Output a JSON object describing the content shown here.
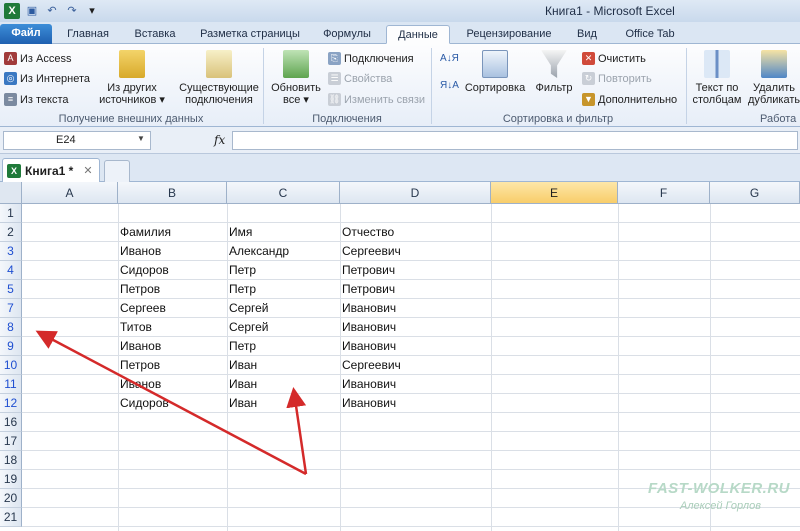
{
  "title_bar": {
    "title": "Книга1 - Microsoft Excel",
    "logo": "X"
  },
  "tabs": [
    {
      "label": "Файл",
      "file": true
    },
    {
      "label": "Главная"
    },
    {
      "label": "Вставка"
    },
    {
      "label": "Разметка страницы"
    },
    {
      "label": "Формулы"
    },
    {
      "label": "Данные",
      "active": true
    },
    {
      "label": "Рецензирование"
    },
    {
      "label": "Вид"
    },
    {
      "label": "Office Tab"
    }
  ],
  "ribbon": {
    "external": {
      "from_access": "Из Access",
      "from_web": "Из Интернета",
      "from_text": "Из текста",
      "other_sources_l1": "Из других",
      "other_sources_l2": "источников ▾",
      "existing_l1": "Существующие",
      "existing_l2": "подключения",
      "group_label": "Получение внешних данных"
    },
    "connections": {
      "refresh_l1": "Обновить",
      "refresh_l2": "все ▾",
      "connections": "Подключения",
      "properties": "Свойства",
      "edit_links": "Изменить связи",
      "group_label": "Подключения"
    },
    "sort_filter": {
      "sort": "Сортировка",
      "filter": "Фильтр",
      "clear": "Очистить",
      "reapply": "Повторить",
      "advanced": "Дополнительно",
      "group_label": "Сортировка и фильтр"
    },
    "data_tools": {
      "text_to_columns_l1": "Текст по",
      "text_to_columns_l2": "столбцам",
      "remove_dup_l1": "Удалить",
      "remove_dup_l2": "дубликаты",
      "group_label": "Работа"
    }
  },
  "formula_bar": {
    "name_box": "E24",
    "fx": "fx",
    "value": ""
  },
  "workbook_tab": {
    "label": "Книга1 *",
    "close": "✕"
  },
  "columns": [
    "A",
    "B",
    "C",
    "D",
    "E",
    "F",
    "G"
  ],
  "rows": [
    {
      "num": "1",
      "cells": [
        "",
        "",
        "",
        ""
      ]
    },
    {
      "num": "2",
      "cells": [
        "",
        "Фамилия",
        "Имя",
        "Отчество"
      ]
    },
    {
      "num": "3",
      "cells": [
        "",
        "Иванов",
        "Александр",
        "Сергеевич"
      ]
    },
    {
      "num": "4",
      "cells": [
        "",
        "Сидоров",
        "Петр",
        "Петрович"
      ]
    },
    {
      "num": "5",
      "cells": [
        "",
        "Петров",
        "Петр",
        "Петрович"
      ]
    },
    {
      "num": "7",
      "cells": [
        "",
        "Сергеев",
        "Сергей",
        "Иванович"
      ]
    },
    {
      "num": "8",
      "cells": [
        "",
        "Титов",
        "Сергей",
        "Иванович"
      ]
    },
    {
      "num": "9",
      "cells": [
        "",
        "Иванов",
        "Петр",
        "Иванович"
      ]
    },
    {
      "num": "10",
      "cells": [
        "",
        "Петров",
        "Иван",
        "Сергеевич"
      ]
    },
    {
      "num": "11",
      "cells": [
        "",
        "Иванов",
        "Иван",
        "Иванович"
      ]
    },
    {
      "num": "12",
      "cells": [
        "",
        "Сидоров",
        "Иван",
        "Иванович"
      ]
    },
    {
      "num": "16",
      "cells": [
        "",
        "",
        "",
        ""
      ]
    },
    {
      "num": "17",
      "cells": [
        "",
        "",
        "",
        ""
      ]
    },
    {
      "num": "18",
      "cells": [
        "",
        "",
        "",
        ""
      ]
    },
    {
      "num": "19",
      "cells": [
        "",
        "",
        "",
        ""
      ]
    },
    {
      "num": "20",
      "cells": [
        "",
        "",
        "",
        ""
      ]
    },
    {
      "num": "21",
      "cells": [
        "",
        "",
        "",
        ""
      ]
    }
  ],
  "watermark": {
    "site": "FAST-WOLKER.RU",
    "author": "Алексей Горлов"
  },
  "colors": {
    "accent": "#1e5fb0",
    "arrow": "#d42a2a",
    "filtered_row_number": "#1f4fd1",
    "selected_column": "#f8cd6a"
  }
}
